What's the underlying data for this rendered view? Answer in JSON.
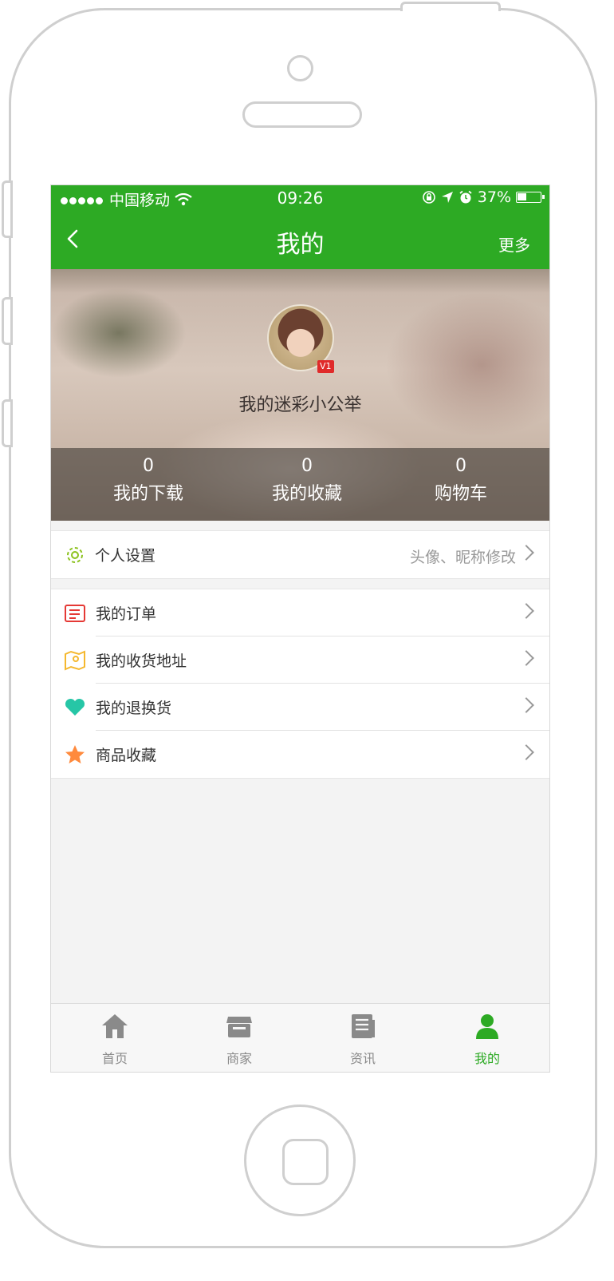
{
  "status_bar": {
    "carrier": "中国移动",
    "time": "09:26",
    "battery_percent": "37%"
  },
  "nav": {
    "title": "我的",
    "more_label": "更多"
  },
  "profile": {
    "nickname": "我的迷彩小公举",
    "vip_badge": "V1",
    "stats": [
      {
        "value": "0",
        "label": "我的下载"
      },
      {
        "value": "0",
        "label": "我的收藏"
      },
      {
        "value": "0",
        "label": "购物车"
      }
    ]
  },
  "settings_row": {
    "label": "个人设置",
    "hint": "头像、昵称修改",
    "icon": "gear-icon"
  },
  "menu": [
    {
      "label": "我的订单",
      "icon": "order-icon"
    },
    {
      "label": "我的收货地址",
      "icon": "map-icon"
    },
    {
      "label": "我的退换货",
      "icon": "heart-icon"
    },
    {
      "label": "商品收藏",
      "icon": "star-icon"
    }
  ],
  "tabs": [
    {
      "label": "首页",
      "icon": "home-icon"
    },
    {
      "label": "商家",
      "icon": "store-icon"
    },
    {
      "label": "资讯",
      "icon": "news-icon"
    },
    {
      "label": "我的",
      "icon": "user-icon",
      "active": true
    }
  ],
  "colors": {
    "brand_green": "#2daa24",
    "vip_red": "#e02a2a"
  }
}
